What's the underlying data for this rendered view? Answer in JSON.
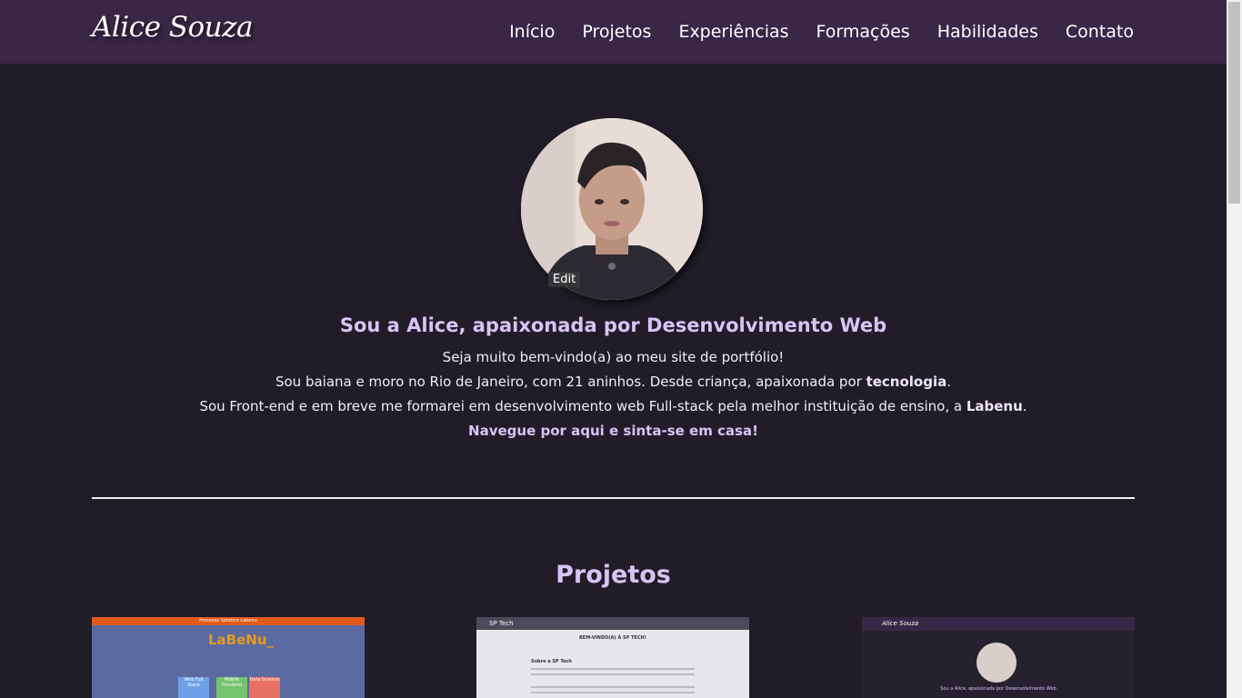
{
  "header": {
    "logo": "Alice Souza",
    "nav": [
      "Início",
      "Projetos",
      "Experiências",
      "Formações",
      "Habilidades",
      "Contato"
    ]
  },
  "hero": {
    "edit_label": "Edit",
    "title": "Sou a Alice, apaixonada por Desenvolvimento Web",
    "line1": "Seja muito bem-vindo(a) ao meu site de portfólio!",
    "line2_pre": "Sou baiana e moro no Rio de Janeiro, com 21 aninhos. Desde criança, apaixonada por ",
    "line2_bold": "tecnologia",
    "line2_post": ".",
    "line3_pre": "Sou Front-end e em breve me formarei em desenvolvimento web Full-stack pela melhor instituição de ensino, a ",
    "line3_bold": "Labenu",
    "line3_post": ".",
    "cta": "Navegue por aqui e sinta-se em casa!"
  },
  "projects": {
    "title": "Projetos",
    "items": [
      {
        "bar": "Processo Seletivo Labenu",
        "logo": "LaBeNu_",
        "boxes": [
          "Web Full Stack",
          "Mobile Frontend",
          "Data Science"
        ]
      },
      {
        "bar": "SP Tech",
        "heading": "BEM-VINDO(A) À SP TECH!",
        "section": "Sobre a SP Tech"
      },
      {
        "logo": "Alice Souza",
        "title": "Sou a Alice, apaixonada por Desenvolvimento Web"
      }
    ]
  },
  "colors": {
    "header_bg": "#3a2647",
    "page_bg": "#201d28",
    "accent": "#d7c3f5"
  }
}
